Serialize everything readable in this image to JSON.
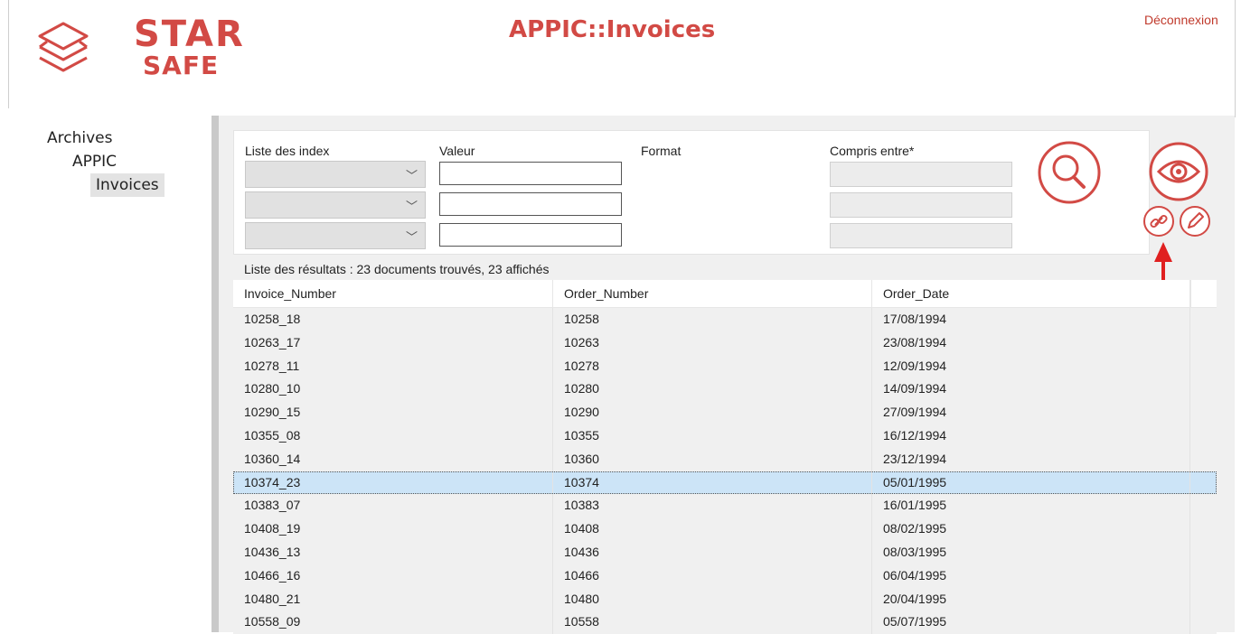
{
  "header": {
    "brand_star": "STAR",
    "brand_safe": "SAFE",
    "app_title": "APPIC::Invoices",
    "logout_label": "Déconnexion"
  },
  "tree": {
    "root": "Archives",
    "child": "APPIC",
    "leaf": "Invoices"
  },
  "search": {
    "index_label": "Liste des index",
    "value_label": "Valeur",
    "format_label": "Format",
    "range_label": "Compris entre*",
    "select_values": [
      "",
      "",
      ""
    ],
    "input_values": [
      "",
      "",
      ""
    ],
    "search_icon": "magnifier-icon",
    "view_icon": "eye-icon",
    "link_icon": "link-icon",
    "edit_icon": "pencil-icon"
  },
  "results": {
    "caption": "Liste des résultats : 23 documents trouvés, 23 affichés",
    "columns": [
      "Invoice_Number",
      "Order_Number",
      "Order_Date"
    ],
    "rows": [
      [
        "10258_18",
        "10258",
        "17/08/1994"
      ],
      [
        "10263_17",
        "10263",
        "23/08/1994"
      ],
      [
        "10278_11",
        "10278",
        "12/09/1994"
      ],
      [
        "10280_10",
        "10280",
        "14/09/1994"
      ],
      [
        "10290_15",
        "10290",
        "27/09/1994"
      ],
      [
        "10355_08",
        "10355",
        "16/12/1994"
      ],
      [
        "10360_14",
        "10360",
        "23/12/1994"
      ],
      [
        "10374_23",
        "10374",
        "05/01/1995"
      ],
      [
        "10383_07",
        "10383",
        "16/01/1995"
      ],
      [
        "10408_19",
        "10408",
        "08/02/1995"
      ],
      [
        "10436_13",
        "10436",
        "08/03/1995"
      ],
      [
        "10466_16",
        "10466",
        "06/04/1995"
      ],
      [
        "10480_21",
        "10480",
        "20/04/1995"
      ],
      [
        "10558_09",
        "10558",
        "05/07/1995"
      ]
    ],
    "selected_row": 7
  },
  "colors": {
    "brand": "#d24a45",
    "selection": "#cce4f7",
    "annotation_arrow": "#e02020"
  }
}
